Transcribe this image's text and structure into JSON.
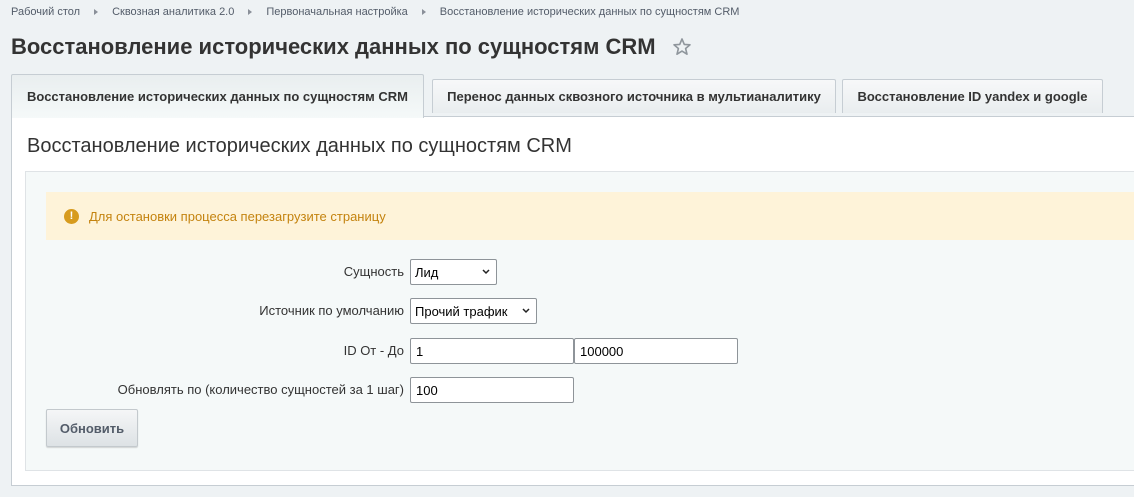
{
  "breadcrumbs": [
    "Рабочий стол",
    "Сквозная аналитика 2.0",
    "Первоначальная настройка",
    "Восстановление исторических данных по сущностям CRM"
  ],
  "page_title": "Восстановление исторических данных по сущностям CRM",
  "tabs": [
    {
      "label": "Восстановление исторических данных по сущностям CRM",
      "active": true
    },
    {
      "label": "Перенос данных сквозного источника в мультианалитику",
      "active": false
    },
    {
      "label": "Восстановление ID yandex и google",
      "active": false
    }
  ],
  "panel": {
    "title": "Восстановление исторических данных по сущностям CRM",
    "notice": "Для остановки процесса перезагрузите страницу",
    "fields": {
      "entity": {
        "label": "Сущность",
        "value": "Лид"
      },
      "source": {
        "label": "Источник по умолчанию",
        "value": "Прочий трафик"
      },
      "id_range": {
        "label": "ID От - До",
        "from": "1",
        "to": "100000"
      },
      "step": {
        "label": "Обновлять по (количество сущностей за 1 шаг)",
        "value": "100"
      }
    },
    "submit_label": "Обновить"
  },
  "colors": {
    "notice_bg": "#fef3d9",
    "notice_text": "#c4830f",
    "warning_icon": "#d79b1e"
  }
}
